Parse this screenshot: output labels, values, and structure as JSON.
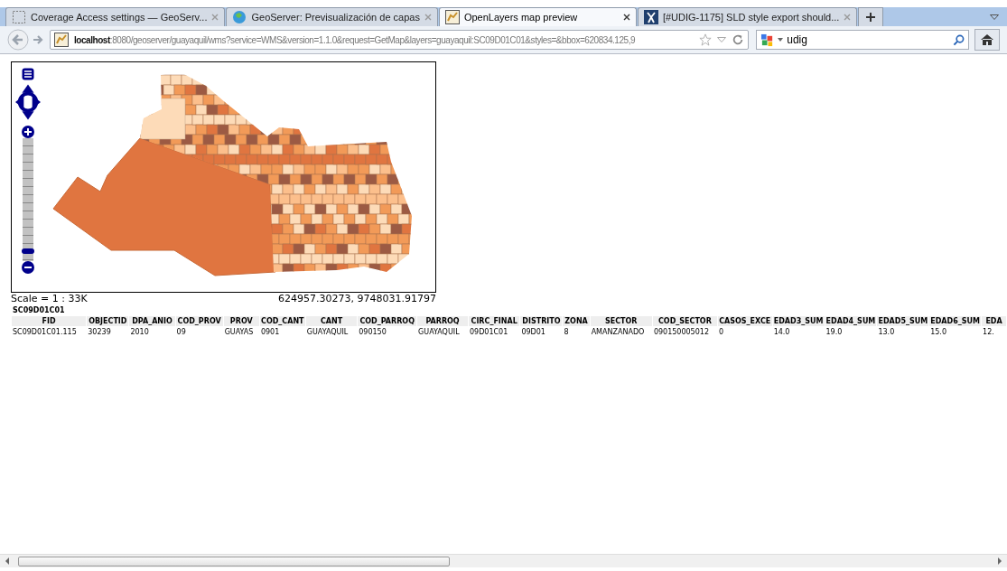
{
  "tabs": [
    {
      "title": "Coverage Access settings — GeoServ...",
      "selected": false
    },
    {
      "title": "GeoServer: Previsualización de capas",
      "selected": false
    },
    {
      "title": "OpenLayers map preview",
      "selected": true
    },
    {
      "title": "[#UDIG-1175] SLD style export should...",
      "selected": false
    }
  ],
  "address_bar": {
    "host": "localhost",
    "rest": ":8080/geoserver/guayaquil/wms?service=WMS&version=1.1.0&request=GetMap&layers=guayaquil:SC09D01C01&styles=&bbox=620834.125,9"
  },
  "search_field": {
    "value": "udig"
  },
  "map": {
    "zoom_slider": {
      "level": 0.06
    },
    "scale": "Scale = 1 : 33K",
    "coordinates": "624957.30273, 9748031.91797"
  },
  "feature_info": {
    "layer": "SC09D01C01",
    "columns": [
      "FID",
      "OBJECTID",
      "DPA_ANIO",
      "COD_PROV",
      "PROV",
      "COD_CANT",
      "CANT",
      "COD_PARROQ",
      "PARROQ",
      "CIRC_FINAL",
      "DISTRITO",
      "ZONA",
      "SECTOR",
      "COD_SECTOR",
      "CASOS_EXCE",
      "EDAD3_SUM",
      "EDAD4_SUM",
      "EDAD5_SUM",
      "EDAD6_SUM",
      "EDA"
    ],
    "rows": [
      [
        "SC09D01C01.115",
        "30239",
        "2010",
        "09",
        "GUAYAS",
        "0901",
        "GUAYAQUIL",
        "090150",
        "GUAYAQUIL",
        "09D01C01",
        "09D01",
        "8",
        "AMANZANADO",
        "090150005012",
        "0",
        "14.0",
        "19.0",
        "13.0",
        "15.0",
        "12."
      ]
    ]
  }
}
